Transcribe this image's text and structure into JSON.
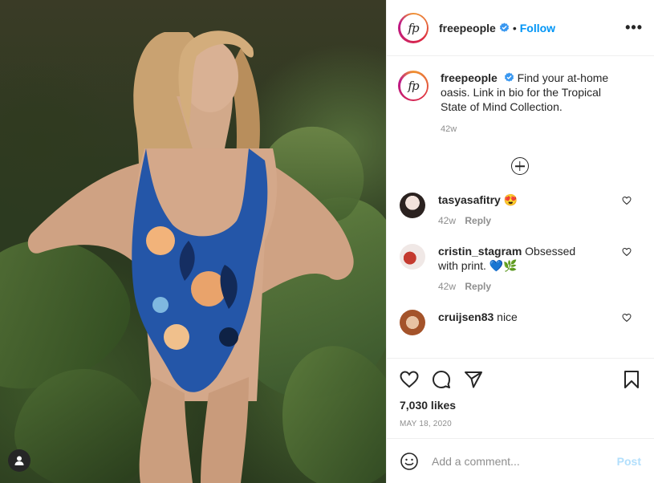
{
  "header": {
    "logo_text": "fp",
    "username": "freepeople",
    "separator": "•",
    "follow_label": "Follow",
    "more_label": "•••"
  },
  "caption": {
    "username": "freepeople",
    "text": "Find your at-home oasis. Link in bio for the Tropical State of Mind Collection.",
    "time": "42w"
  },
  "comments": [
    {
      "username": "tasyasafitry",
      "text": "😍",
      "time": "42w",
      "reply_label": "Reply",
      "avatar_color": "#d9c7c0"
    },
    {
      "username": "cristin_stagram",
      "text": "Obsessed with print. 💙🌿",
      "time": "42w",
      "reply_label": "Reply",
      "avatar_color": "#c43a2f"
    },
    {
      "username": "cruijsen83",
      "text": "nice",
      "time": "",
      "reply_label": "",
      "avatar_color": "#c7936b"
    }
  ],
  "likes": "7,030 likes",
  "date": "MAY 18, 2020",
  "add_comment": {
    "placeholder": "Add a comment...",
    "post_label": "Post"
  },
  "colors": {
    "accent": "#0095f6",
    "post_disabled": "#b2dffc",
    "muted": "#8e8e8e"
  }
}
